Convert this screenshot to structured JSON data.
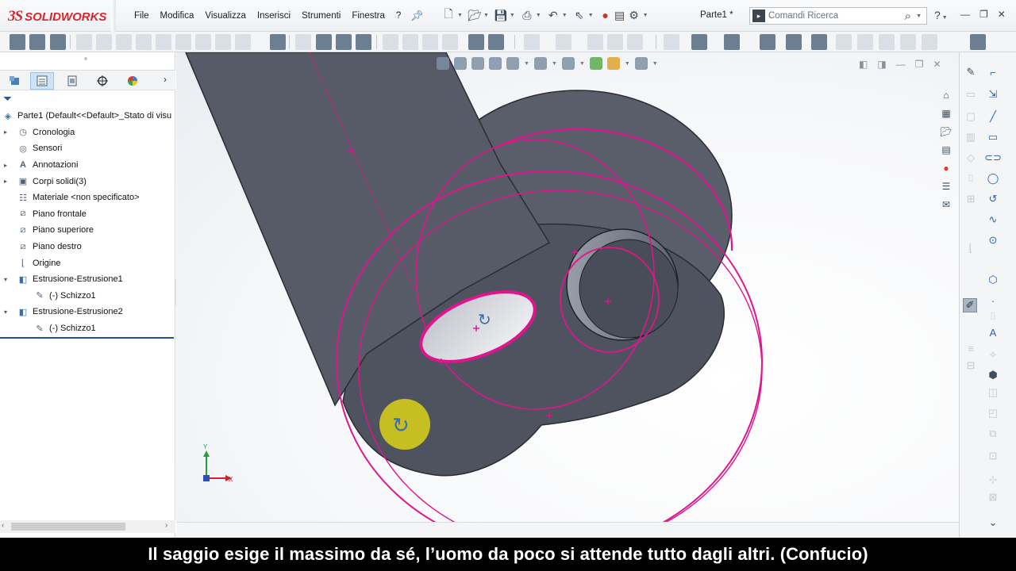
{
  "app": {
    "logo_prefix": "3S",
    "logo_name": "SOLIDWORKS",
    "document_title": "Parte1 *"
  },
  "menu": {
    "items": [
      "File",
      "Modifica",
      "Visualizza",
      "Inserisci",
      "Strumenti",
      "Finestra",
      "?"
    ]
  },
  "search": {
    "placeholder": "Comandi Ricerca"
  },
  "help_label": "?",
  "feature_manager": {
    "tabs": [
      "featuremanager-tree",
      "property-manager",
      "configuration-manager",
      "dimxpert-manager",
      "display-manager"
    ],
    "tree": [
      {
        "label": "Parte1  (Default<<Default>_Stato di visu",
        "expander": "",
        "icon": "part-icon",
        "indent": 0
      },
      {
        "label": "Cronologia",
        "expander": "▸",
        "icon": "history-icon",
        "indent": 1
      },
      {
        "label": "Sensori",
        "expander": "",
        "icon": "sensor-icon",
        "indent": 1
      },
      {
        "label": "Annotazioni",
        "expander": "▸",
        "icon": "annotation-icon",
        "indent": 1
      },
      {
        "label": "Corpi solidi(3)",
        "expander": "▸",
        "icon": "solid-bodies-icon",
        "indent": 1
      },
      {
        "label": "Materiale <non specificato>",
        "expander": "",
        "icon": "material-icon",
        "indent": 1
      },
      {
        "label": "Piano frontale",
        "expander": "",
        "icon": "plane-icon",
        "indent": 1
      },
      {
        "label": "Piano superiore",
        "expander": "",
        "icon": "plane-icon",
        "indent": 1
      },
      {
        "label": "Piano destro",
        "expander": "",
        "icon": "plane-icon",
        "indent": 1
      },
      {
        "label": "Origine",
        "expander": "",
        "icon": "origin-icon",
        "indent": 1
      },
      {
        "label": "Estrusione-Estrusione1",
        "expander": "▾",
        "icon": "extrude-icon",
        "indent": 1
      },
      {
        "label": "(-) Schizzo1",
        "expander": "",
        "icon": "sketch-icon",
        "indent": 2
      },
      {
        "label": "Estrusione-Estrusione2",
        "expander": "▾",
        "icon": "extrude-icon",
        "indent": 1
      },
      {
        "label": "(-) Schizzo1",
        "expander": "",
        "icon": "sketch-icon",
        "indent": 2
      }
    ]
  },
  "viewport": {
    "triad_x": "X",
    "triad_y": "Y"
  },
  "colors": {
    "sketch_magenta": "#e0148c",
    "model_dark": "#585c68",
    "selection_blue": "#1f4fa8",
    "cursor_yellow": "#d9d21a"
  },
  "subtitle": {
    "text": "Il saggio esige il massimo da sé, l’uomo da poco si attende tutto dagli altri. (Confucio)"
  }
}
